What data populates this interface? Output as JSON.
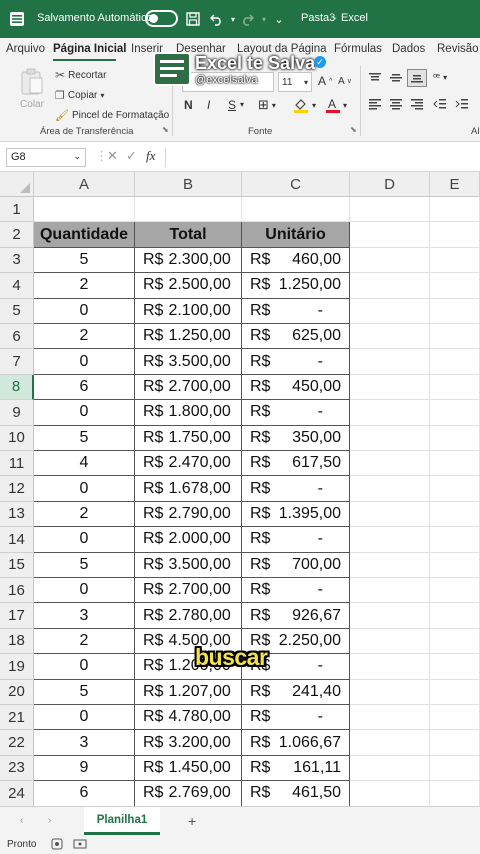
{
  "titlebar": {
    "autosave_label": "Salvamento Automático",
    "doc_title": "Pasta3",
    "separator": "-",
    "app_name": "Excel"
  },
  "menu": {
    "tabs": [
      "Arquivo",
      "Página Inicial",
      "Inserir",
      "Desenhar",
      "Layout da Página",
      "Fórmulas",
      "Dados",
      "Revisão"
    ]
  },
  "ribbon": {
    "paste_label": "Colar",
    "cut_label": "Recortar",
    "copy_label": "Copiar",
    "format_painter_label": "Pincel de Formatação",
    "clipboard_group": "Área de Transferência",
    "font_name": "",
    "font_size": "11",
    "bold": "N",
    "italic": "I",
    "underline": "S",
    "font_group": "Fonte",
    "truncated_group": "Al"
  },
  "watermark": {
    "brand": "Excel te Salva",
    "handle": "@excelsalva"
  },
  "formula_bar": {
    "name_box": "G8",
    "fx": "fx",
    "value": ""
  },
  "columns": [
    "A",
    "B",
    "C",
    "D",
    "E"
  ],
  "headers": {
    "quantity": "Quantidade",
    "total": "Total",
    "unit": "Unitário"
  },
  "rows": [
    {
      "n": "1"
    },
    {
      "n": "2"
    },
    {
      "n": "3",
      "qty": "5",
      "total": "2.300,00",
      "unit": "460,00"
    },
    {
      "n": "4",
      "qty": "2",
      "total": "2.500,00",
      "unit": "1.250,00"
    },
    {
      "n": "5",
      "qty": "0",
      "total": "2.100,00",
      "unit": "-"
    },
    {
      "n": "6",
      "qty": "2",
      "total": "1.250,00",
      "unit": "625,00"
    },
    {
      "n": "7",
      "qty": "0",
      "total": "3.500,00",
      "unit": "-"
    },
    {
      "n": "8",
      "qty": "6",
      "total": "2.700,00",
      "unit": "450,00"
    },
    {
      "n": "9",
      "qty": "0",
      "total": "1.800,00",
      "unit": "-"
    },
    {
      "n": "10",
      "qty": "5",
      "total": "1.750,00",
      "unit": "350,00"
    },
    {
      "n": "11",
      "qty": "4",
      "total": "2.470,00",
      "unit": "617,50"
    },
    {
      "n": "12",
      "qty": "0",
      "total": "1.678,00",
      "unit": "-"
    },
    {
      "n": "13",
      "qty": "2",
      "total": "2.790,00",
      "unit": "1.395,00"
    },
    {
      "n": "14",
      "qty": "0",
      "total": "2.000,00",
      "unit": "-"
    },
    {
      "n": "15",
      "qty": "5",
      "total": "3.500,00",
      "unit": "700,00"
    },
    {
      "n": "16",
      "qty": "0",
      "total": "2.700,00",
      "unit": "-"
    },
    {
      "n": "17",
      "qty": "3",
      "total": "2.780,00",
      "unit": "926,67"
    },
    {
      "n": "18",
      "qty": "2",
      "total": "4.500,00",
      "unit": "2.250,00"
    },
    {
      "n": "19",
      "qty": "0",
      "total": "1.200,00",
      "unit": "-"
    },
    {
      "n": "20",
      "qty": "5",
      "total": "1.207,00",
      "unit": "241,40"
    },
    {
      "n": "21",
      "qty": "0",
      "total": "4.780,00",
      "unit": "-"
    },
    {
      "n": "22",
      "qty": "3",
      "total": "3.200,00",
      "unit": "1.066,67"
    },
    {
      "n": "23",
      "qty": "9",
      "total": "1.450,00",
      "unit": "161,11"
    },
    {
      "n": "24",
      "qty": "6",
      "total": "2.769,00",
      "unit": "461,50"
    }
  ],
  "currency": "R$",
  "selected_row": "8",
  "caption": "buscar",
  "sheet": {
    "active_tab": "Planilha1",
    "add": "+"
  },
  "status": {
    "ready": "Pronto"
  },
  "colors": {
    "excel_green": "#217346",
    "header_fill": "#a6a6a6",
    "caption_yellow": "#f5e34a"
  }
}
